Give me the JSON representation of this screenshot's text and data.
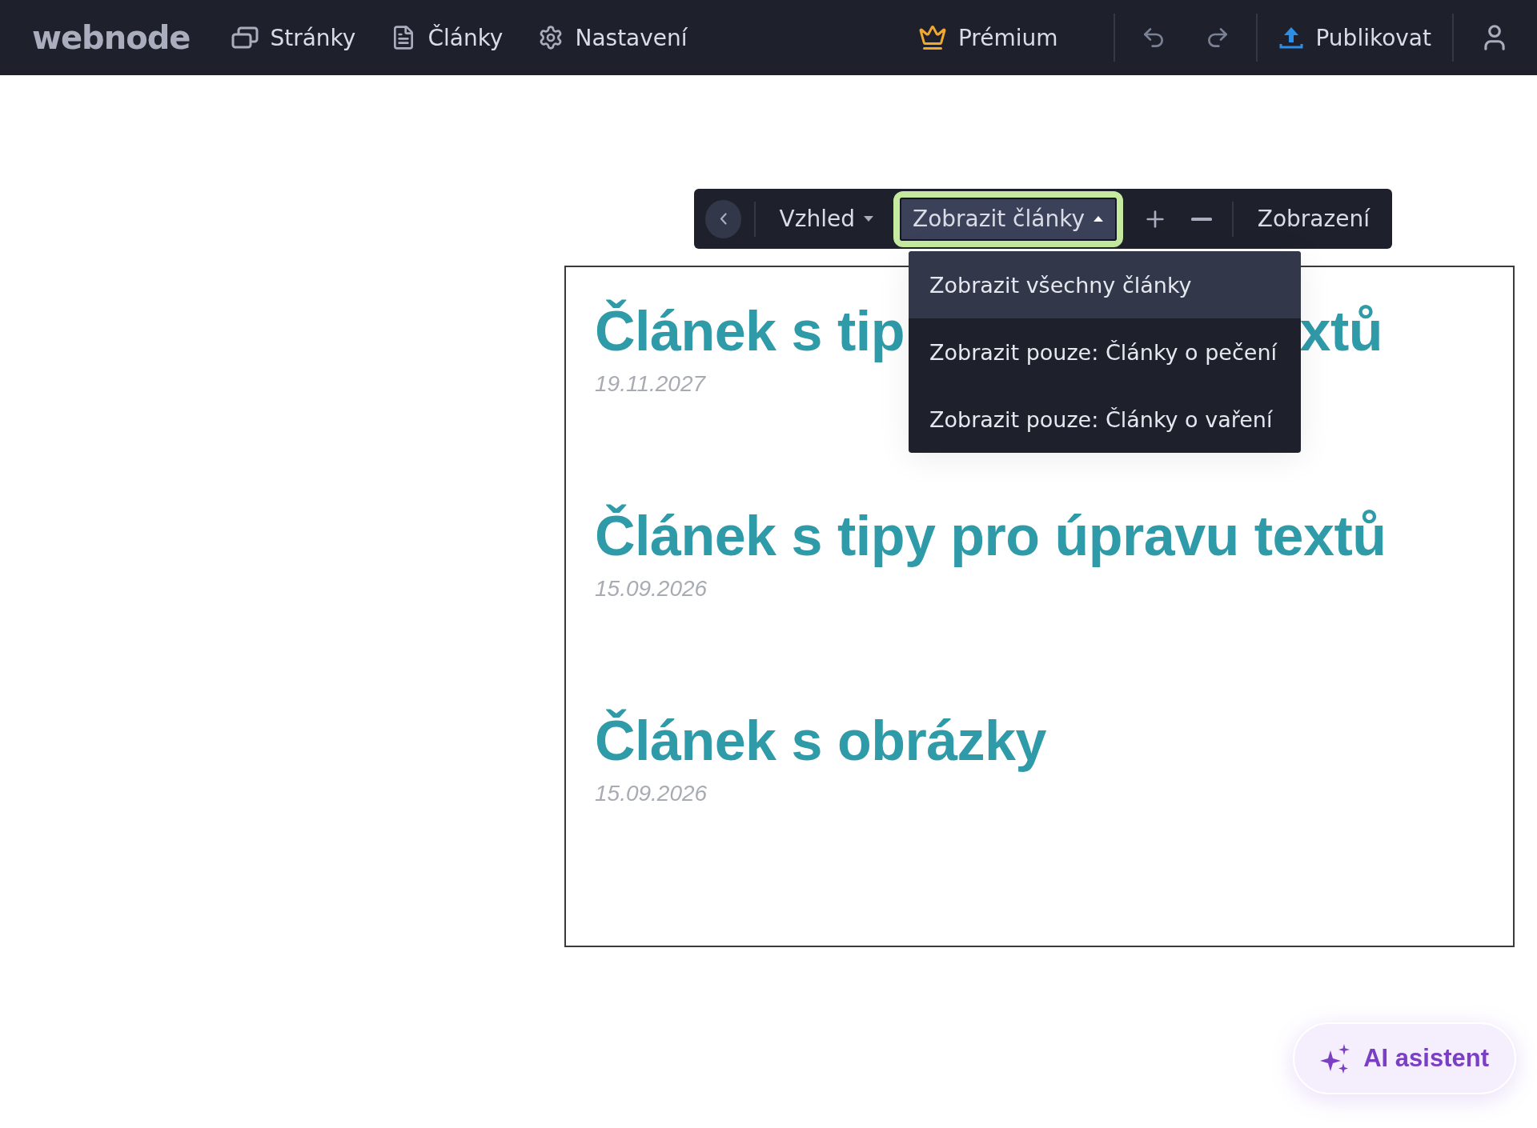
{
  "topbar": {
    "logo": "webnode",
    "nav": [
      {
        "label": "Stránky"
      },
      {
        "label": "Články"
      },
      {
        "label": "Nastavení"
      }
    ],
    "premium": "Prémium",
    "publish": "Publikovat"
  },
  "toolbar": {
    "appearance": "Vzhled",
    "filter": {
      "label": "Zobrazit články",
      "expanded": true
    },
    "view": "Zobrazení"
  },
  "dropdown": [
    {
      "label": "Zobrazit všechny články",
      "selected": true
    },
    {
      "label": "Zobrazit pouze: Články o pečení",
      "selected": false
    },
    {
      "label": "Zobrazit pouze: Články o vaření",
      "selected": false
    }
  ],
  "articles": [
    {
      "title_parts": [
        "Článek s tip",
        "xtů"
      ],
      "date": "19.11.2027"
    },
    {
      "title": "Článek s tipy pro úpravu textů",
      "date": "15.09.2026"
    },
    {
      "title": "Článek s obrázky",
      "date": "15.09.2026"
    }
  ],
  "ai_button": "AI asistent"
}
